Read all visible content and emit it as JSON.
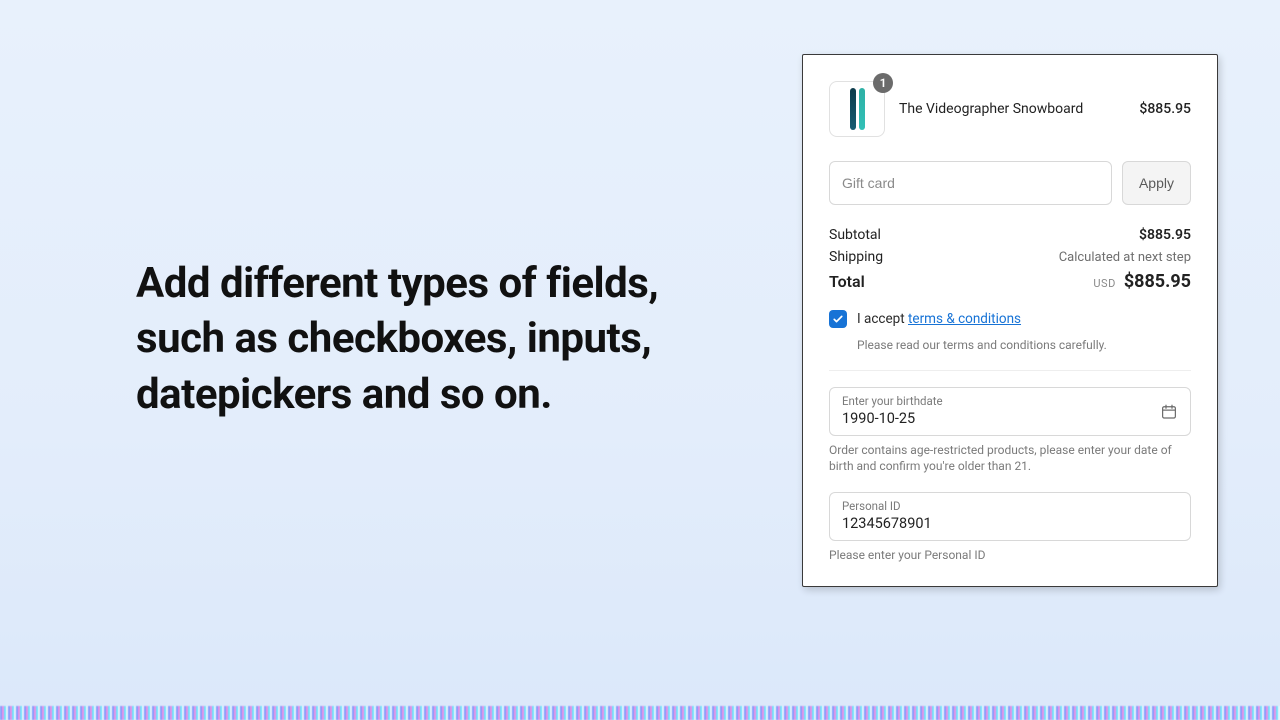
{
  "headline": "Add different types of fields, such as checkboxes, inputs, datepickers and so on.",
  "line_item": {
    "qty": "1",
    "name": "The Videographer Snowboard",
    "price": "$885.95"
  },
  "gift": {
    "placeholder": "Gift card",
    "apply_label": "Apply"
  },
  "totals": {
    "subtotal_label": "Subtotal",
    "subtotal_value": "$885.95",
    "shipping_label": "Shipping",
    "shipping_value": "Calculated at next step",
    "total_label": "Total",
    "currency": "USD",
    "total_value": "$885.95"
  },
  "terms": {
    "prefix": "I accept ",
    "link": "terms & conditions",
    "hint": "Please read our terms and conditions carefully."
  },
  "birthdate": {
    "label": "Enter your birthdate",
    "value": "1990-10-25",
    "help": "Order contains age-restricted products, please enter your date of birth and confirm you're older than 21."
  },
  "personal_id": {
    "label": "Personal ID",
    "value": "12345678901",
    "help": "Please enter your Personal ID"
  }
}
